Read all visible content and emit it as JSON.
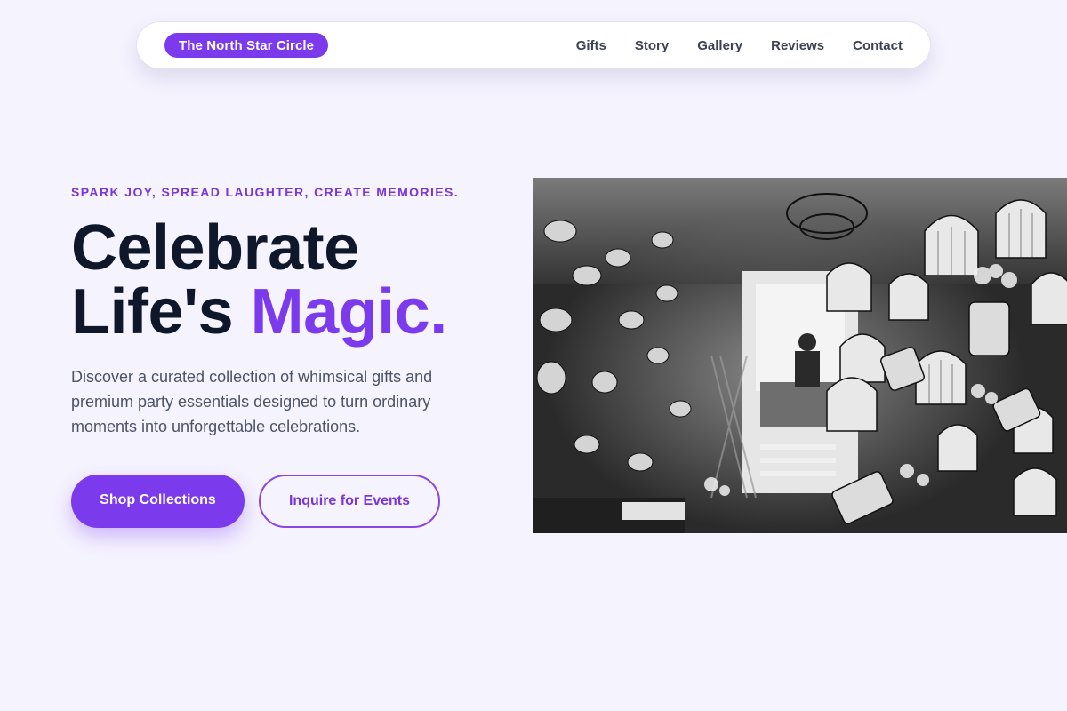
{
  "nav": {
    "brand": "The North Star Circle",
    "links": [
      {
        "label": "Gifts"
      },
      {
        "label": "Story"
      },
      {
        "label": "Gallery"
      },
      {
        "label": "Reviews"
      },
      {
        "label": "Contact"
      }
    ]
  },
  "hero": {
    "eyebrow": "SPARK JOY, SPREAD LAUGHTER, CREATE MEMORIES.",
    "headline_line1": "Celebrate",
    "headline_line2_plain": "Life's ",
    "headline_line2_accent": "Magic.",
    "description": "Discover a curated collection of whimsical gifts and premium party essentials designed to turn ordinary moments into unforgettable celebrations.",
    "primary_cta": "Shop Collections",
    "secondary_cta": "Inquire for Events"
  },
  "colors": {
    "background": "#f5f3fe",
    "accent": "#7c3aed",
    "heading": "#0f172a",
    "body_text": "#4b5366",
    "nav_link": "#3b4255"
  }
}
